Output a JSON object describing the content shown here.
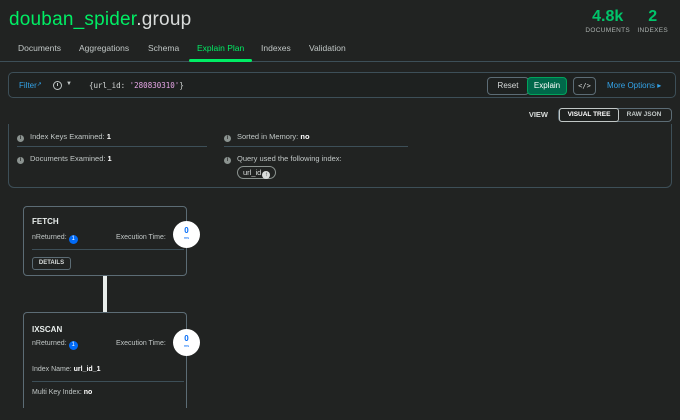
{
  "header": {
    "db_name": "douban_spider",
    "collection_name": ".group",
    "documents_count": "4.8k",
    "documents_label": "DOCUMENTS",
    "indexes_count": "2",
    "indexes_label": "INDEXES"
  },
  "tabs": [
    {
      "label": "Documents"
    },
    {
      "label": "Aggregations"
    },
    {
      "label": "Schema"
    },
    {
      "label": "Explain Plan",
      "active": true
    },
    {
      "label": "Indexes"
    },
    {
      "label": "Validation"
    }
  ],
  "query_bar": {
    "filter_label": "Filter",
    "query_key": "{url_id: ",
    "query_value": "'280830310'",
    "query_close": "}",
    "reset_label": "Reset",
    "explain_label": "Explain",
    "code_label": "</>",
    "more_options_label": "More Options ▸"
  },
  "view": {
    "label": "VIEW",
    "visual_tree_label": "VISUAL TREE",
    "raw_json_label": "RAW JSON"
  },
  "summary": {
    "index_keys_label": "Index Keys Examined: ",
    "index_keys_value": "1",
    "docs_examined_label": "Documents Examined: ",
    "docs_examined_value": "1",
    "sorted_label": "Sorted in Memory: ",
    "sorted_value": "no",
    "query_index_label": "Query used the following index:",
    "index_name": "url_id"
  },
  "stages": [
    {
      "name": "FETCH",
      "nreturned_label": "nReturned:",
      "nreturned": "1",
      "exec_label": "Execution Time:",
      "exec_time": "0",
      "exec_unit": "ms",
      "details_label": "DETAILS"
    },
    {
      "name": "IXSCAN",
      "nreturned_label": "nReturned:",
      "nreturned": "1",
      "exec_label": "Execution Time:",
      "exec_time": "0",
      "exec_unit": "ms",
      "index_name_label": "Index Name: ",
      "index_name": "url_id_1",
      "multikey_label": "Multi Key Index: ",
      "multikey": "no"
    }
  ],
  "colors": {
    "accent_green": "#00ed64",
    "link_blue": "#33a3e8",
    "badge_blue": "#016bf8",
    "background": "#212322"
  }
}
